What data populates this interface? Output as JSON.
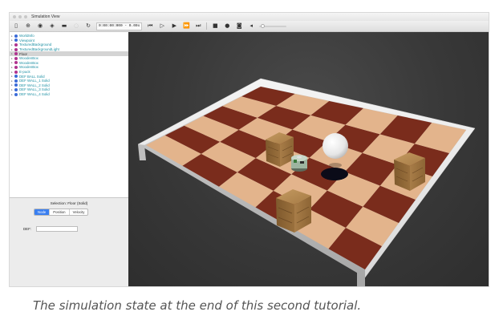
{
  "window": {
    "title": "Simulation View"
  },
  "toolbar": {
    "sim_time": "0:00:00:000 - 0.00x",
    "icons": [
      "scene-tree-toggle-icon",
      "add-node-icon",
      "open-world-icon",
      "save-world-icon",
      "reload-world-icon",
      "reset-icon",
      "step-icon",
      "real-time-icon",
      "play-icon",
      "fast-icon",
      "record-icon",
      "screenshot-icon",
      "sound-icon"
    ]
  },
  "scene_tree": {
    "items": [
      {
        "label": "WorldInfo",
        "color": "#3a6bd8"
      },
      {
        "label": "Viewpoint",
        "color": "#3a6bd8"
      },
      {
        "label": "TexturedBackground",
        "color": "#b0338f"
      },
      {
        "label": "TexturedBackgroundLight",
        "color": "#b0338f"
      },
      {
        "label": "Floor",
        "color": "#b0338f",
        "selected": true
      },
      {
        "label": "WoodenBox",
        "color": "#b0338f"
      },
      {
        "label": "WoodenBox",
        "color": "#b0338f"
      },
      {
        "label": "WoodenBox",
        "color": "#b0338f"
      },
      {
        "label": "E-puck",
        "color": "#b0338f"
      },
      {
        "label": "DEF BALL Solid",
        "color": "#3a6bd8"
      },
      {
        "label": "DEF WALL_1 Solid",
        "color": "#3a6bd8"
      },
      {
        "label": "DEF WALL_2 Solid",
        "color": "#3a6bd8"
      },
      {
        "label": "DEF WALL_3 Solid",
        "color": "#3a6bd8"
      },
      {
        "label": "DEF WALL_4 Solid",
        "color": "#3a6bd8"
      }
    ],
    "text_color": "#1c8fa3"
  },
  "selection_panel": {
    "title": "Selection: Floor (Solid)",
    "tabs": [
      "Node",
      "Position",
      "Velocity"
    ],
    "active_tab": "Node",
    "def_label": "DEF:",
    "def_value": ""
  },
  "caption": "The simulation state at the end of this second tutorial."
}
